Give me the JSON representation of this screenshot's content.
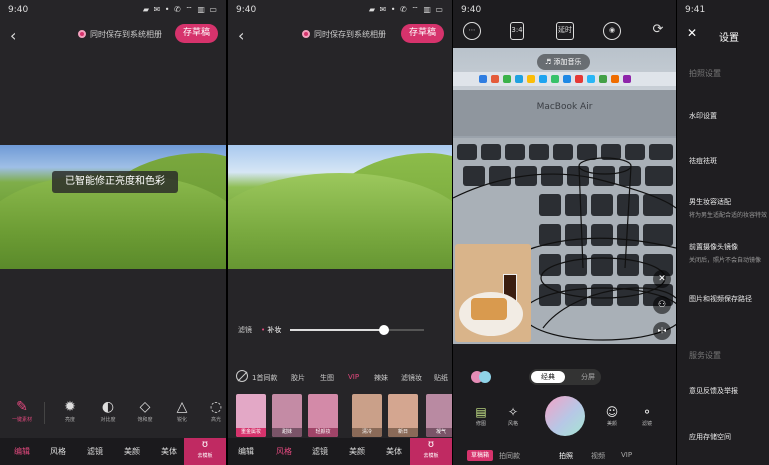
{
  "status": [
    {
      "time": "9:40",
      "icons": "▰ ✉ •     ✆ ⌔ ▥ ▭"
    },
    {
      "time": "9:40",
      "icons": "▰ ✉ •     ✆ ⌔ ▥ ▭"
    },
    {
      "time": "9:40",
      "icons": "▰ ✉ •"
    },
    {
      "time": "9:41",
      "icons": "▰ ✉ •"
    }
  ],
  "editor": {
    "back_glyph": "‹",
    "save_to_album_label": "同时保存到系统相册",
    "save_draft_button": "存草稿",
    "toast": "已智能修正亮度和色彩",
    "tools": [
      {
        "icon": "eraser-glyph",
        "glyph": "✎",
        "label": "一键素材"
      },
      {
        "icon": "brightness-icon",
        "glyph": "✹",
        "label": "亮度"
      },
      {
        "icon": "contrast-icon",
        "glyph": "◐",
        "label": "对比度"
      },
      {
        "icon": "saturation-icon",
        "glyph": "◇",
        "label": "饱和度"
      },
      {
        "icon": "sharpen-icon",
        "glyph": "△",
        "label": "锐化"
      },
      {
        "icon": "highlight-icon",
        "glyph": "◌",
        "label": "高光"
      }
    ],
    "nav": [
      "编辑",
      "风格",
      "滤镜",
      "美颜",
      "美体"
    ],
    "beauty_cta": {
      "glyph": "ʊ",
      "label": "去模板"
    }
  },
  "filter": {
    "slider_label": "滤镜",
    "slider_filter_name": "补妆",
    "slider_value": 0.7,
    "tabs": [
      "1首同款",
      "胶片",
      "生图",
      "VIP",
      "辣妹",
      "滤镜妆",
      "贴纸"
    ],
    "thumbs": [
      {
        "caption": "重金属妆",
        "color": "#e3a8c6"
      },
      {
        "caption": "甜妹",
        "color": "#c48ba5"
      },
      {
        "caption": "轻颜妆",
        "color": "#d38aa8"
      },
      {
        "caption": "清冷",
        "color": "#caa089"
      },
      {
        "caption": "新日",
        "color": "#d4a690"
      },
      {
        "caption": "凝气",
        "color": "#b98aa2"
      }
    ],
    "nav": [
      "编辑",
      "风格",
      "滤镜",
      "美颜",
      "美体"
    ],
    "selected_nav": "风格",
    "beauty_cta": {
      "glyph": "ʊ",
      "label": "去模板"
    }
  },
  "camera": {
    "top_icons": [
      "⋯",
      "3:4",
      "延时",
      "◉",
      "⟳"
    ],
    "music_label": "♬ 添加音乐",
    "screen_text": "MacBook Air",
    "mode_on": "经典",
    "mode_off": "分屏",
    "tools_left": [
      {
        "glyph": "▤",
        "label": "修图"
      },
      {
        "glyph": "✧",
        "label": "风格"
      }
    ],
    "tools_right": [
      {
        "glyph": "☺",
        "label": "美颜"
      },
      {
        "glyph": "⚬",
        "label": "滤镜"
      }
    ],
    "capture_nav": {
      "draft": "草稿箱",
      "items": [
        "拍同款",
        "拍照",
        "视频",
        "VIP"
      ],
      "selected": "拍照"
    },
    "overlay_buttons": [
      "✕",
      "⚇",
      "▸|◂"
    ]
  },
  "settings": {
    "close_glyph": "✕",
    "title": "设置",
    "section_capture": "拍照设置",
    "rows": [
      {
        "label": "水印设置",
        "sub": ""
      },
      {
        "label": "祛痘祛斑",
        "sub": ""
      },
      {
        "label": "男生妆容适配",
        "sub": "将为男生适配合适的妆容特效"
      },
      {
        "label": "前置摄像头镜像",
        "sub": "关闭后，照片不会自动镜像"
      },
      {
        "label": "图片和视频保存路径",
        "sub": ""
      }
    ],
    "section_service": "服务设置",
    "service_rows": [
      "意见反馈及举报",
      "应用存储空间"
    ]
  },
  "colors": {
    "accent": "#d6336c"
  }
}
